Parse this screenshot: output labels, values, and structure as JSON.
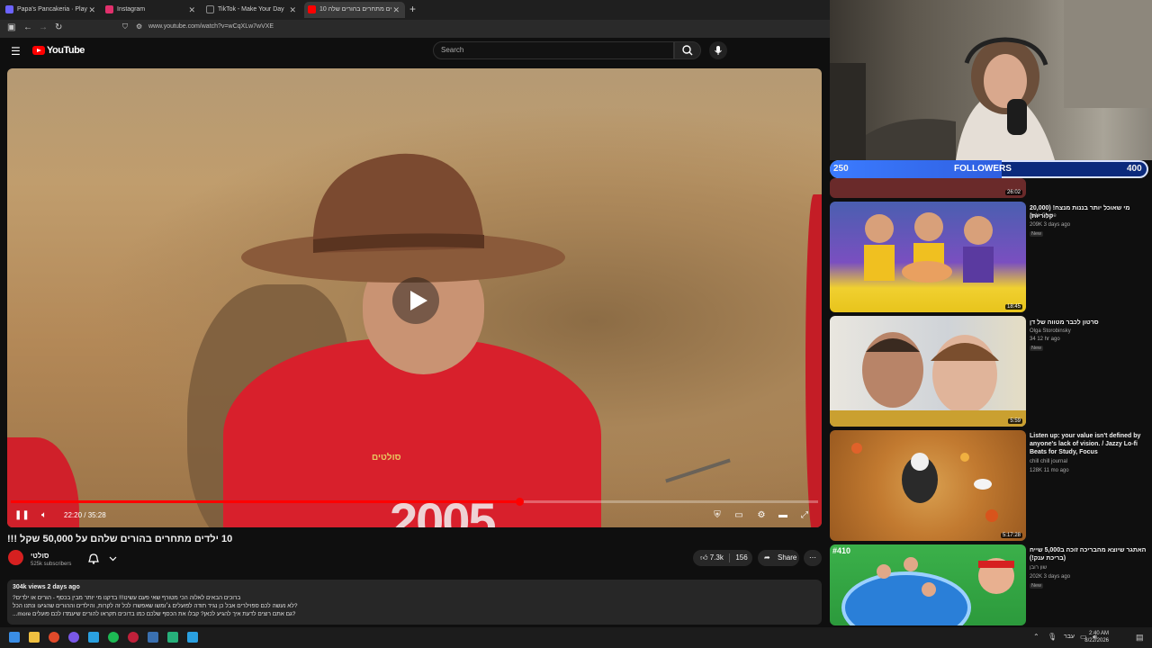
{
  "browser": {
    "tabs": [
      {
        "label": "Papa's Pancakeria · Play",
        "color": "#6c63ff"
      },
      {
        "label": "Instagram",
        "color": "#e1306c"
      },
      {
        "label": "TikTok - Make Your Day",
        "color": "#222222"
      },
      {
        "label": "10 ילדים מתחרים בהורים שלה",
        "color": "#ff0000"
      }
    ],
    "url": "www.youtube.com/watch?v=wCqXLw7wVXE"
  },
  "youtube": {
    "brand": "YouTube",
    "search_placeholder": "Search"
  },
  "video": {
    "time": "22:20 / 35:28",
    "progress": 0.63,
    "shirt_text": "סולטים",
    "shirt_number": "2005"
  },
  "meta": {
    "title": "10 ילדים מתחרים בהורים שלהם על 50,000 שקל !!!",
    "channel": "סולטי",
    "subscribers": "525k subscribers",
    "likes": "7.3k",
    "dislikes": "156",
    "share": "Share",
    "more": "⋯"
  },
  "description": {
    "meta": "304k views  2 days ago",
    "lines": [
      "ברוכים הבאים לאלוה הכי מטורף שאי פעם עשינו!!! בדקנו מי יותר מבין בכסף - הורים או ילדים?",
      "?לא נעשה לכם ספוילרים אבל כן נגיד תודה לפועלים ג׳ומשו שאפשרו לכל זה לקרות, והילדים וההורים שהגיעו ונתנו הכל",
      "...more   גם אתם רוצים לדעת איך להגיע לכאן? קבלו את הכסף שלכם כמו בדוכים תקראו להורים שיעמדו לכם פועלים?"
    ]
  },
  "stream": {
    "followers_current": "250",
    "followers_label": "FOLLOWERS",
    "followers_goal": "400",
    "progress": 0.54
  },
  "sidebar": {
    "items": [
      {
        "duration": "26:02"
      },
      {
        "title": "מי שאוכל יותר בננות מנצח! (20,000 קלוריות)",
        "channel": "Inde Game",
        "views": "209K  3 days ago",
        "badge": "New",
        "duration": "18:45"
      },
      {
        "title": "סרטון לכבר מטווה של דן",
        "channel": "Olga Storobinsky",
        "views": "34  12 hr ago",
        "badge": "New",
        "duration": "5:59"
      },
      {
        "title": "Listen up: your value isn't defined by anyone's lack of vision. / Jazzy Lo-fi Beats for Study, Focus",
        "channel": "chill chill journal",
        "views": "128K  11 mo ago",
        "badge": "",
        "duration": "5:17:28"
      },
      {
        "title": "האתגר שיוצא מהבריכה זוכה ב5,000 שייח (בריכת ענק!)",
        "channel": "שון רובן",
        "views": "202K  3 days ago",
        "badge": "New",
        "overlay": "#410"
      }
    ]
  },
  "taskbar": {
    "lang": "עבר",
    "time": "2:40 AM",
    "date": "8/22/2026"
  },
  "colors": {
    "accent": "#ff0000",
    "bg": "#0f0f0f"
  }
}
